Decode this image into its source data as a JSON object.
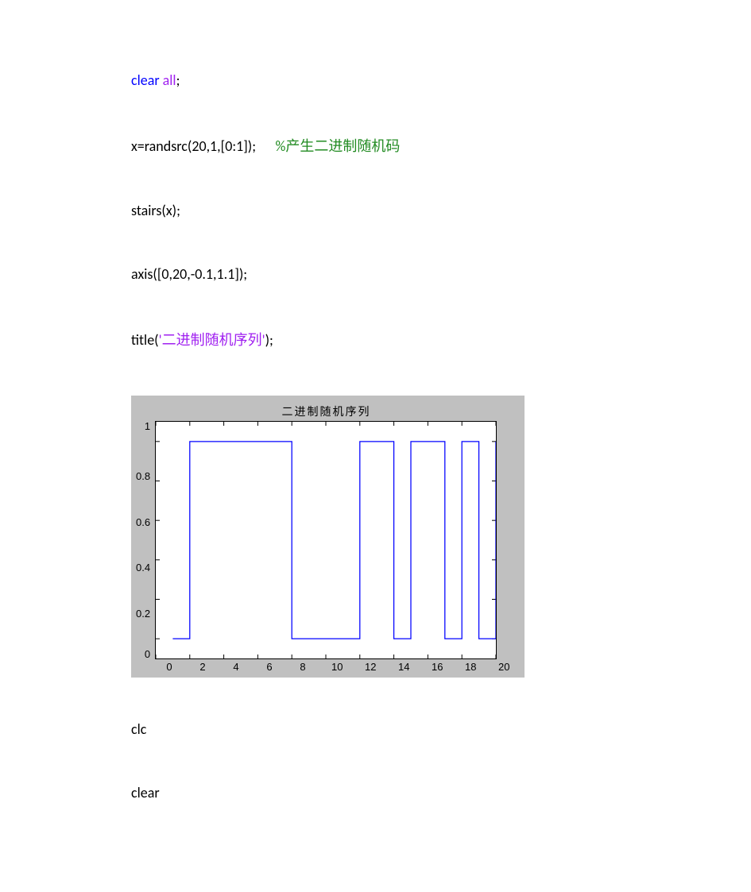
{
  "code": {
    "line1_kw_clear": "clear",
    "line1_kw_all": " all",
    "line1_semicolon": ";",
    "line2_main": "x=randsrc(20,1,[0:1]);      ",
    "line2_comment": "%产生二进制随机码",
    "line3": "stairs(x);",
    "line4": "axis([0,20,-0.1,1.1]);",
    "line5_a": "title(",
    "line5_str": "'二进制随机序列'",
    "line5_b": ");",
    "line6": "clc",
    "line7": "clear"
  },
  "chart_data": {
    "type": "line",
    "title": "二进制随机序列",
    "xlabel": "",
    "ylabel": "",
    "xlim": [
      0,
      20
    ],
    "ylim": [
      -0.1,
      1.1
    ],
    "x_ticks": [
      0,
      2,
      4,
      6,
      8,
      10,
      12,
      14,
      16,
      18,
      20
    ],
    "y_ticks": [
      0,
      0.2,
      0.4,
      0.6,
      0.8,
      1
    ],
    "categories": [
      1,
      2,
      3,
      4,
      5,
      6,
      7,
      8,
      9,
      10,
      11,
      12,
      13,
      14,
      15,
      16,
      17,
      18,
      19,
      20
    ],
    "values": [
      0,
      1,
      1,
      1,
      1,
      1,
      1,
      0,
      0,
      0,
      0,
      1,
      1,
      0,
      1,
      1,
      0,
      1,
      0,
      1
    ],
    "grid": false,
    "line_color": "#0000ff"
  }
}
